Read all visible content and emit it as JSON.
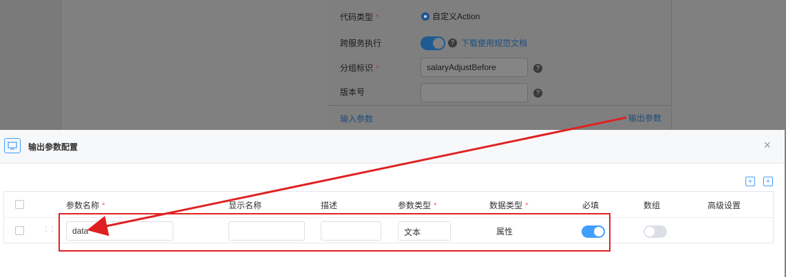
{
  "background_form": {
    "code_type_label": "代码类型",
    "code_type_value": "自定义Action",
    "cross_service_label": "跨服务执行",
    "doc_link": "下载使用规范文档",
    "group_id_label": "分组标识",
    "group_id_value": "salaryAdjustBefore",
    "version_label": "版本号",
    "version_value": "",
    "tab_input": "输入参数",
    "tab_output": "输出参数",
    "help_glyph": "?",
    "required_mark": "*"
  },
  "modal": {
    "title": "输出参数配置",
    "close_glyph": "×",
    "add_glyph": "+",
    "columns": {
      "name": "参数名称",
      "display_name": "显示名称",
      "desc": "描述",
      "param_type": "参数类型",
      "data_type": "数据类型",
      "required": "必填",
      "array": "数组",
      "advanced": "高级设置"
    },
    "rows": [
      {
        "name": "data",
        "display_name": "",
        "desc": "",
        "param_type": "文本",
        "data_type": "属性",
        "required": true,
        "array": false
      }
    ]
  },
  "colors": {
    "accent": "#409eff",
    "annotation_red": "#e02020",
    "required_star": "#f56c6c"
  }
}
